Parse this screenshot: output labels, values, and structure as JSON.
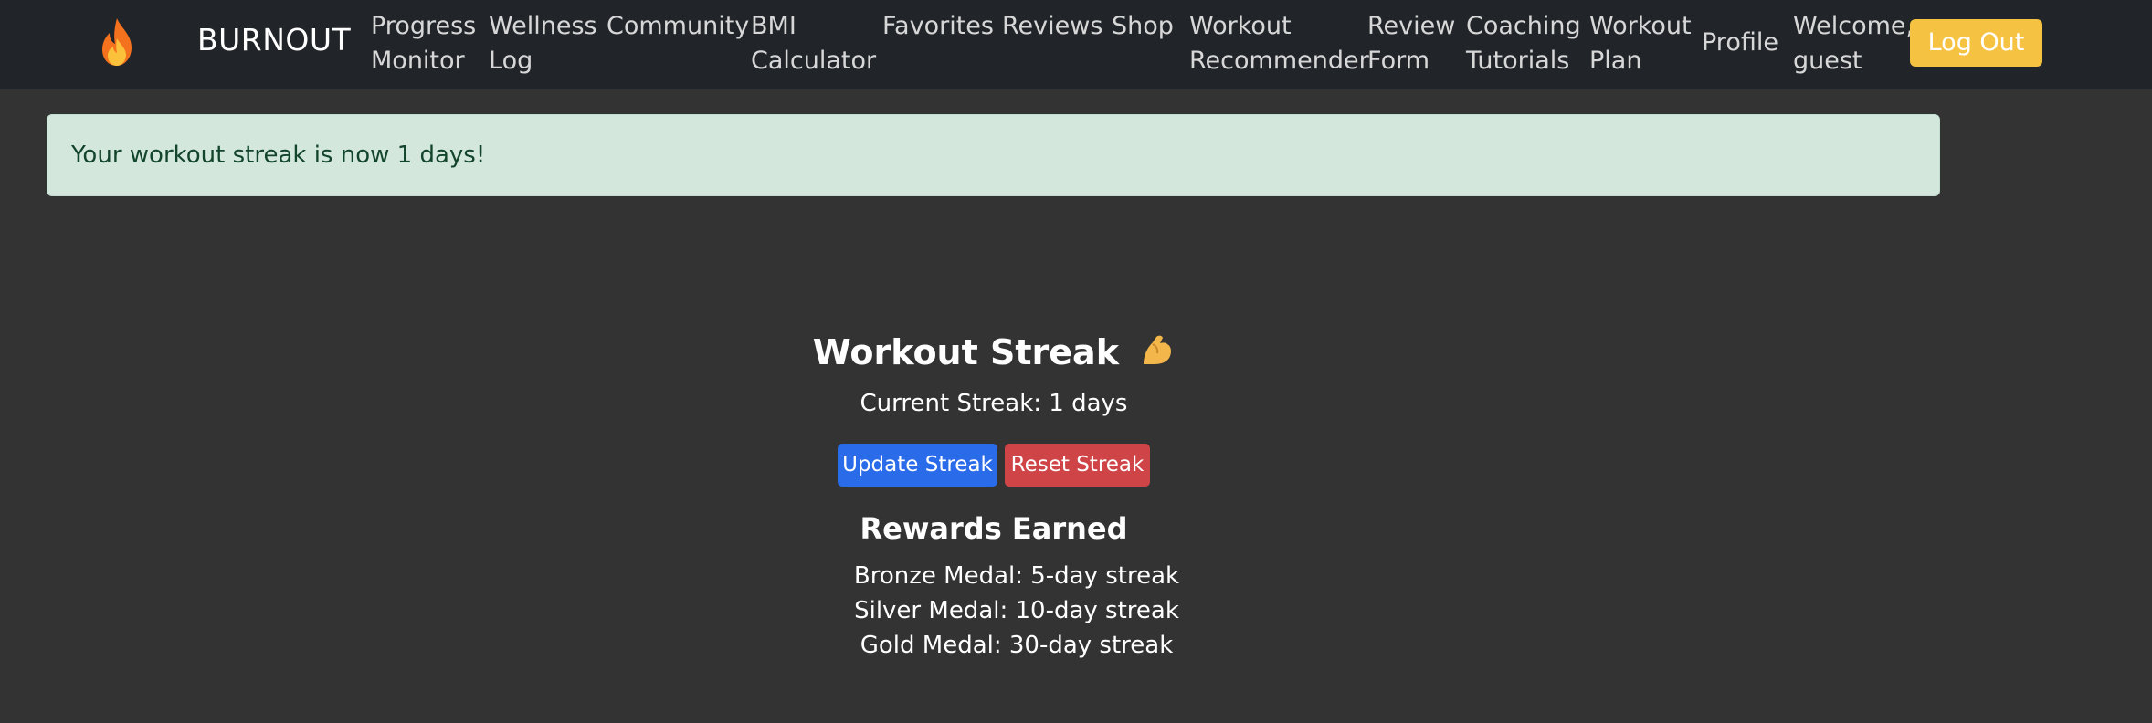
{
  "navbar": {
    "brand_icon": "fire-icon",
    "brand_name": "BURNOUT",
    "items": [
      {
        "line1": "Progress",
        "line2": "Monitor"
      },
      {
        "line1": "Wellness",
        "line2": "Log"
      },
      {
        "line1": "Community",
        "line2": ""
      },
      {
        "line1": "BMI",
        "line2": "Calculator"
      },
      {
        "line1": "Favorites",
        "line2": ""
      },
      {
        "line1": "Reviews",
        "line2": ""
      },
      {
        "line1": "Shop",
        "line2": ""
      },
      {
        "line1": "Workout",
        "line2": "Recommender"
      },
      {
        "line1": "Review",
        "line2": "Form"
      },
      {
        "line1": "Coaching",
        "line2": "Tutorials"
      },
      {
        "line1": "Workout",
        "line2": "Plan"
      },
      {
        "line1": "Profile",
        "line2": ""
      }
    ],
    "welcome": {
      "line1": "Welcome,",
      "line2": "guest"
    },
    "logout_label": "Log Out"
  },
  "alert": {
    "message": "Your workout streak is now 1 days!"
  },
  "streak": {
    "title": "Workout Streak",
    "title_icon": "flexed-biceps-icon",
    "current": "Current Streak: 1 days",
    "update_label": "Update Streak",
    "reset_label": "Reset Streak"
  },
  "rewards": {
    "title": "Rewards Earned",
    "items": [
      "Bronze Medal: 5-day streak",
      "Silver Medal: 10-day streak",
      "Gold Medal: 30-day streak"
    ]
  },
  "colors": {
    "navbar_bg": "#212529",
    "page_bg": "#333333",
    "alert_bg": "#d4e7dd",
    "alert_text": "#12452b",
    "logout_bg": "#f5c242",
    "update_bg": "#2a6bea",
    "reset_bg": "#cf4447"
  }
}
